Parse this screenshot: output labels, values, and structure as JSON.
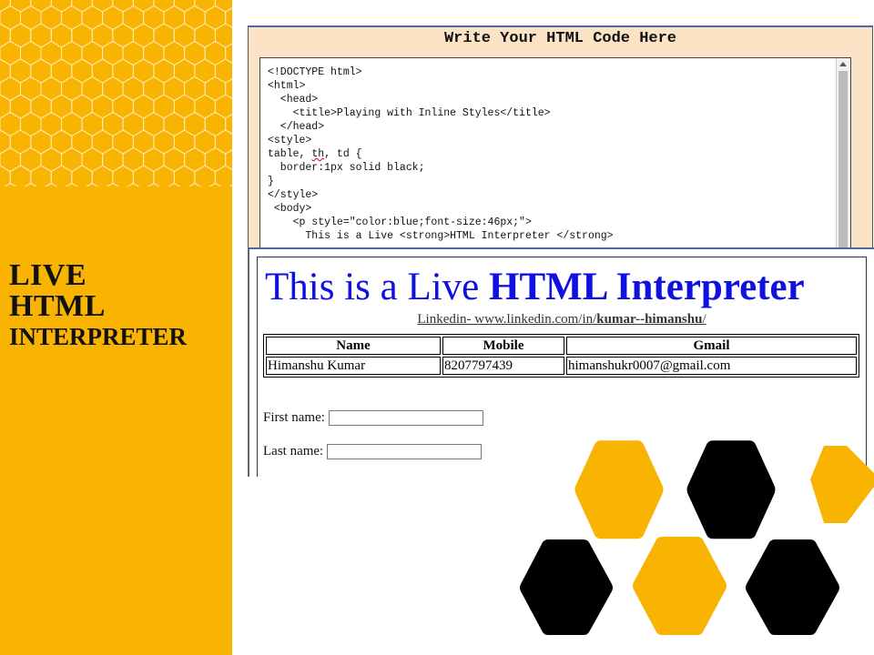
{
  "slide": {
    "title_line1": "LIVE",
    "title_line2": "HTML",
    "title_line3": "INTERPRETER"
  },
  "editor": {
    "heading": "Write Your HTML Code Here",
    "code_lines": [
      "<!DOCTYPE html>",
      "<html>",
      "  <head>",
      "    <title>Playing with Inline Styles</title>",
      "  </head>",
      "<style>",
      "table, th, td {",
      "  border:1px solid black;",
      "}",
      "</style>",
      " <body>",
      "    <p style=\"color:blue;font-size:46px;\">",
      "      This is a Live <strong>HTML Interpreter </strong>"
    ]
  },
  "output": {
    "heading_plain": "This is a Live ",
    "heading_strong": "HTML Interpreter",
    "linkedin_prefix": "Linkedin- www.linkedin.com/in/",
    "linkedin_handle": "kumar--himanshu",
    "linkedin_suffix": "/",
    "table": {
      "headers": [
        "Name",
        "Mobile",
        "Gmail"
      ],
      "rows": [
        [
          "Himanshu Kumar",
          "8207797439",
          "himanshukr0007@gmail.com"
        ]
      ]
    },
    "form": {
      "first_label": "First name:",
      "first_value": "",
      "last_label": "Last name:",
      "last_value": ""
    }
  },
  "colors": {
    "accent_yellow": "#f8b400",
    "hex_black": "#000000",
    "editor_bg": "#fde3c6",
    "heading_blue": "#1010e0"
  }
}
